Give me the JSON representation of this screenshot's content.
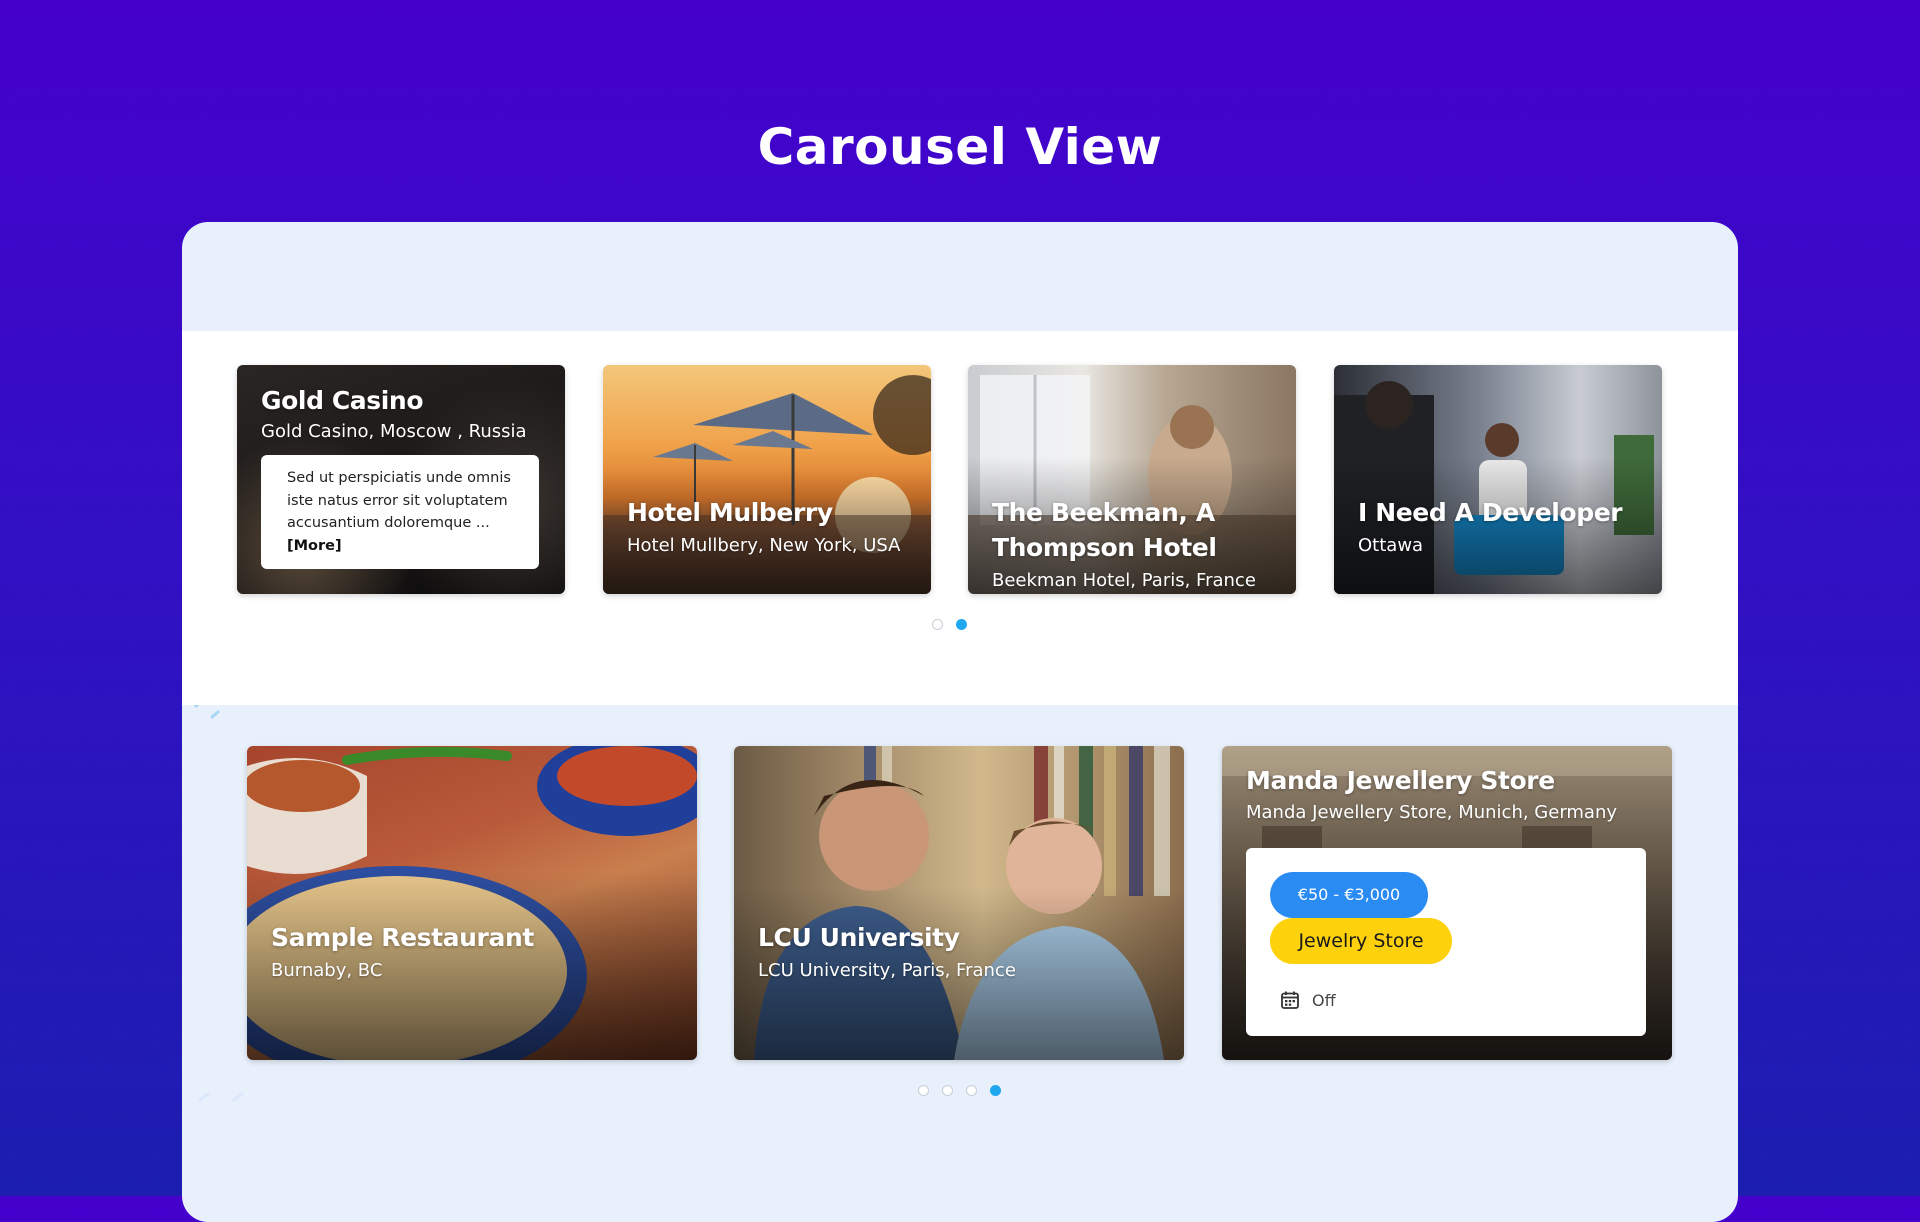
{
  "page": {
    "title": "Carousel View"
  },
  "carousel_top": {
    "cards": [
      {
        "title": "Gold Casino",
        "subtitle": "Gold Casino, Moscow , Russia",
        "description": "Sed ut perspiciatis unde omnis iste natus error sit voluptatem accusantium doloremque ...",
        "more_label": "[More]"
      },
      {
        "title": "Hotel Mulberry",
        "subtitle": "Hotel Mullbery, New York, USA"
      },
      {
        "title_line1": "The Beekman, A",
        "title_line2": "Thompson Hotel",
        "subtitle": "Beekman Hotel, Paris, France"
      },
      {
        "title": "I Need A Developer",
        "subtitle": "Ottawa"
      }
    ],
    "pagination": {
      "count": 2,
      "active": 2
    }
  },
  "carousel_bottom": {
    "cards": [
      {
        "title": "Sample Restaurant",
        "subtitle": "Burnaby, BC"
      },
      {
        "title": "LCU University",
        "subtitle": "LCU University, Paris, France"
      },
      {
        "title": "Manda Jewellery Store",
        "subtitle": "Manda Jewellery Store, Munich, Germany",
        "price_range": "€50 - €3,000",
        "category": "Jewelry Store",
        "status_label": "Off",
        "status_icon": "calendar-icon"
      }
    ],
    "pagination": {
      "count": 4,
      "active": 4
    }
  },
  "colors": {
    "background_top": "#4500cc",
    "background_bottom": "#1c1eb0",
    "panel": "#e8f0fc",
    "dot_active": "#1fa7f0",
    "price_pill": "#2a8bf2",
    "category_pill": "#fdd10c"
  }
}
